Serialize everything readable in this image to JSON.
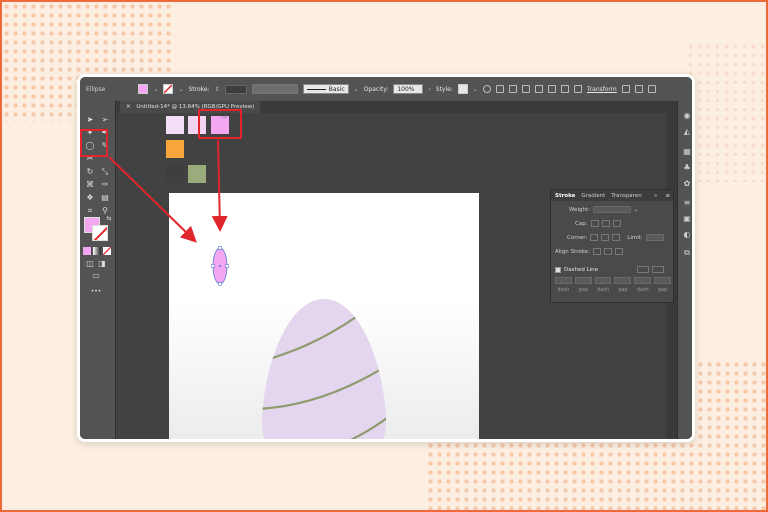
{
  "control_bar": {
    "tool_name": "Ellipse",
    "stroke_label": "Stroke:",
    "profile_label": "Basic",
    "opacity_label": "Opacity:",
    "opacity_value": "100%",
    "style_label": "Style:",
    "transform_label": "Transform",
    "fill_color": "#f3a6f2"
  },
  "document_tab": {
    "close_symbol": "✕",
    "title": "Untitled-14* @ 13.64% (RGB/GPU Preview)"
  },
  "swatches": {
    "colors": [
      "#f3e0f7",
      "#f3d4f3",
      "#f3a6f2",
      "#f7a63b",
      "#3f3f3f",
      "#9aac7b"
    ]
  },
  "toolbar": {
    "fill_color": "#f3a6f2",
    "more_label": "•••"
  },
  "stroke_panel": {
    "tabs": [
      "Stroke",
      "Gradient",
      "Transparen"
    ],
    "weight_label": "Weight:",
    "cap_label": "Cap:",
    "corner_label": "Corner:",
    "limit_label": "Limit:",
    "align_label": "Align Stroke:",
    "dashed_label": "Dashed Line",
    "dash_cells": [
      "dash",
      "gap",
      "dash",
      "gap",
      "dash",
      "gap"
    ]
  },
  "artwork": {
    "egg_color": "#e3d6ee",
    "stripe_color": "#8f9a6e",
    "small_ellipse_color": "#f3a6f2"
  },
  "annotation_color": "#e0262b"
}
